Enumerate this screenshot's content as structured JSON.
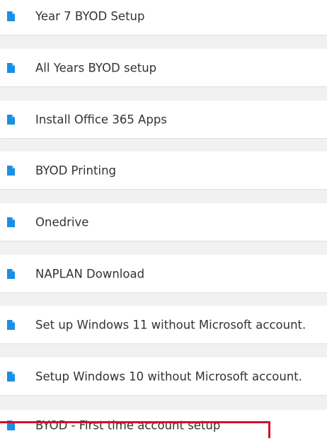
{
  "list": {
    "items": [
      {
        "label": "Year 7 BYOD Setup",
        "icon": "document-icon"
      },
      {
        "label": "All Years BYOD setup",
        "icon": "document-icon"
      },
      {
        "label": "Install Office 365 Apps",
        "icon": "document-icon"
      },
      {
        "label": "BYOD Printing",
        "icon": "document-icon"
      },
      {
        "label": "Onedrive",
        "icon": "document-icon"
      },
      {
        "label": "NAPLAN Download",
        "icon": "document-icon"
      },
      {
        "label": "Set up Windows 11 without Microsoft account.",
        "icon": "document-icon"
      },
      {
        "label": "Setup Windows 10 without Microsoft account.",
        "icon": "document-icon"
      },
      {
        "label": "BYOD - First time account setup",
        "icon": "document-icon"
      }
    ]
  },
  "colors": {
    "icon": "#1a8fe3",
    "highlight": "#d0112b",
    "background": "#f1f1f1",
    "card": "#ffffff"
  }
}
